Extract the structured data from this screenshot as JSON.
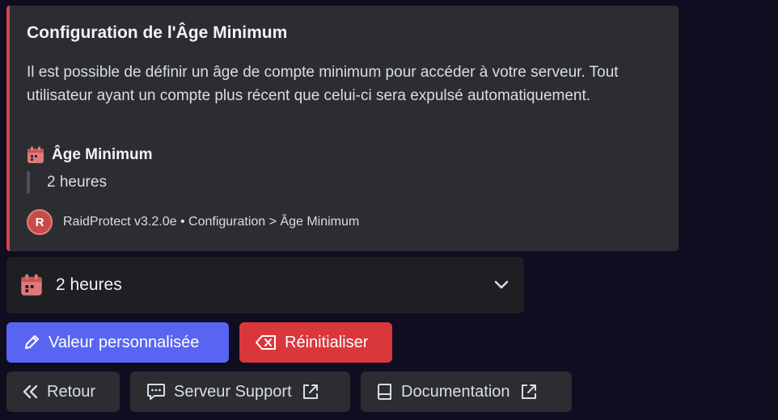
{
  "embed": {
    "title": "Configuration de l'Âge Minimum",
    "description": "Il est possible de définir un âge de compte minimum pour accéder à votre serveur. Tout utilisateur ayant un compte plus récent que celui-ci sera expulsé automatiquement.",
    "field": {
      "icon": "calendar-icon",
      "name": "Âge Minimum",
      "value": "2 heures"
    },
    "footer": {
      "avatar_letter": "R",
      "text": "RaidProtect v3.2.0e • Configuration > Âge Minimum"
    },
    "accent_color": "#d9434b"
  },
  "select": {
    "icon": "calendar-icon",
    "value": "2 heures"
  },
  "buttons": {
    "custom_value": {
      "label": "Valeur personnalisée",
      "icon": "pencil-icon",
      "color": "#5865f2"
    },
    "reset": {
      "label": "Réinitialiser",
      "icon": "backspace-icon",
      "color": "#da373c"
    },
    "back": {
      "label": "Retour",
      "icon": "double-chevron-left-icon"
    },
    "support": {
      "label": "Serveur Support",
      "icon": "chat-bubble-icon"
    },
    "docs": {
      "label": "Documentation",
      "icon": "book-icon"
    }
  }
}
